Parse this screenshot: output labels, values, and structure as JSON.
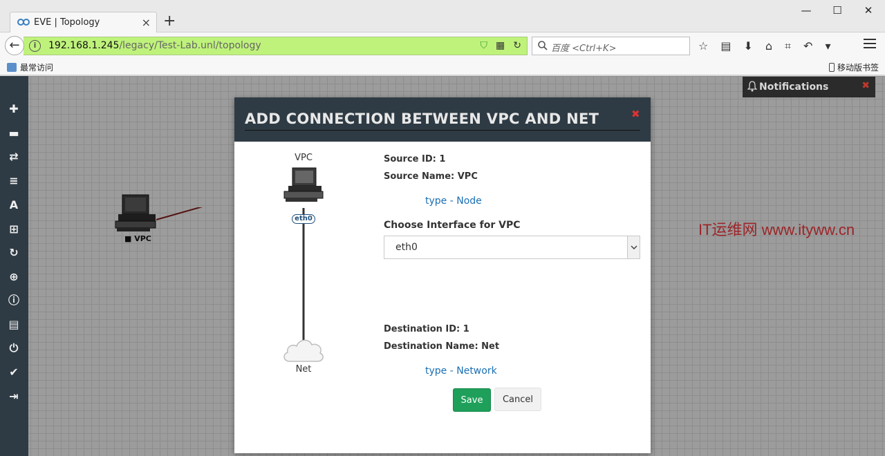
{
  "browser": {
    "tab_title": "EVE | Topology",
    "url_host": "192.168.1.245",
    "url_path": "/legacy/Test-Lab.unl/topology",
    "search_placeholder": "百度 <Ctrl+K>",
    "bookmark_label": "最常访问",
    "mobile_bookmarks_label": "移动版书签"
  },
  "topology": {
    "vpc_node_label": "VPC",
    "notifications_label": "Notifications"
  },
  "watermark": "IT运维网 www.ityww.cn",
  "modal": {
    "title": "ADD CONNECTION BETWEEN VPC AND NET",
    "diagram": {
      "source_label": "VPC",
      "interface_badge": "eth0",
      "destination_label": "Net"
    },
    "source_id": "Source ID: 1",
    "source_name": "Source Name: VPC",
    "source_type": "type - Node",
    "choose_interface_label": "Choose Interface for VPC",
    "interface_selected": "eth0",
    "destination_id": "Destination ID: 1",
    "destination_name": "Destination Name: Net",
    "destination_type": "type - Network",
    "save_label": "Save",
    "cancel_label": "Cancel"
  },
  "colors": {
    "sidebar": "#2f3b44",
    "url_bar": "#bff27b",
    "save_button": "#1fa05a",
    "link": "#1a6fb3",
    "close": "#d33333"
  }
}
